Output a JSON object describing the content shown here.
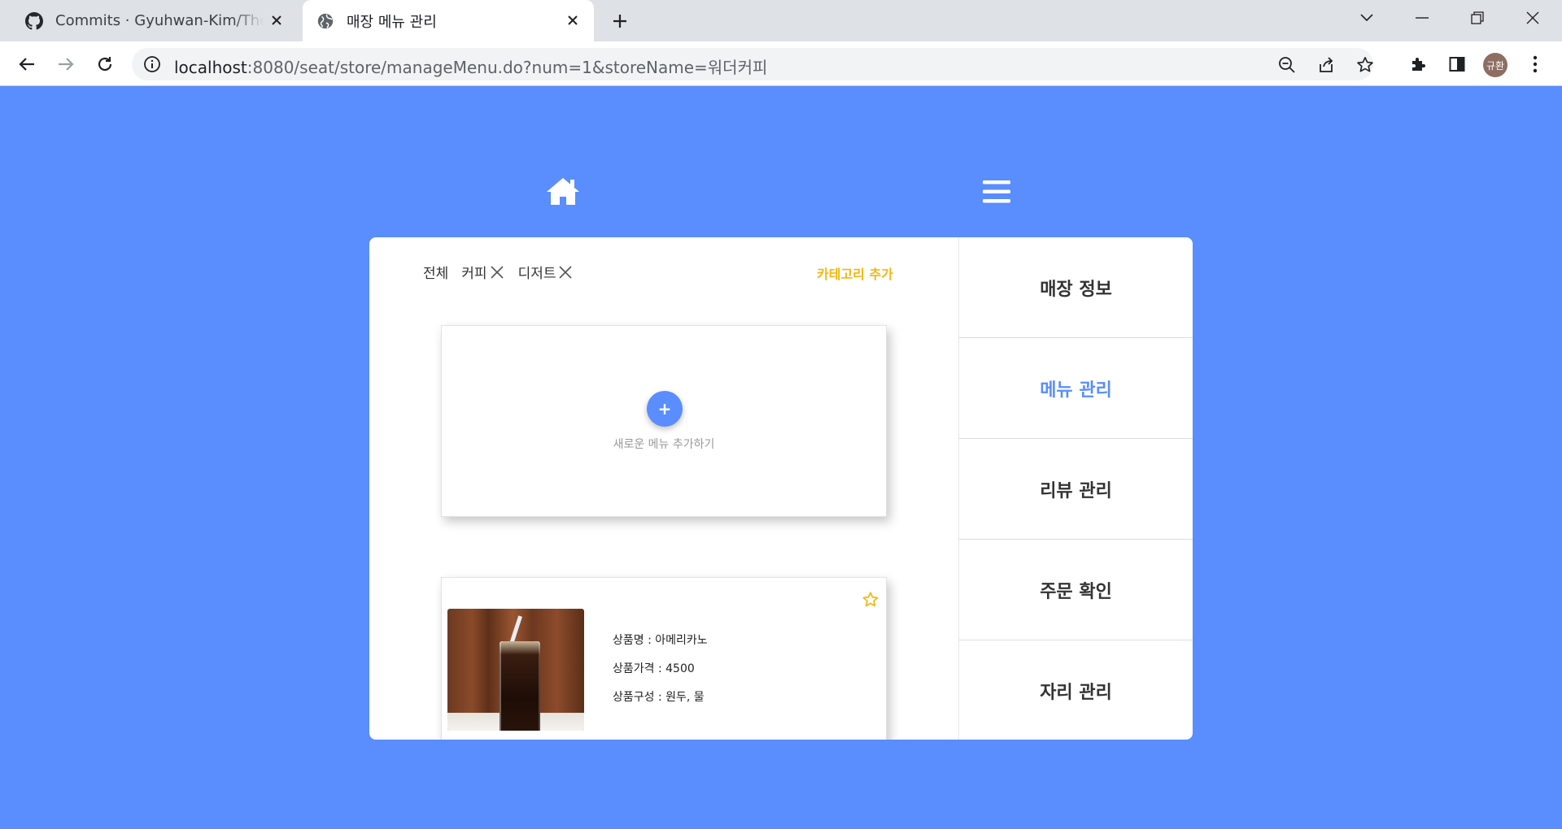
{
  "browser": {
    "tabs": [
      {
        "title": "Commits · Gyuhwan-Kim/TheSeat",
        "icon": "github-icon",
        "active": false
      },
      {
        "title": "매장 메뉴 관리",
        "icon": "globe-icon",
        "active": true
      }
    ],
    "url_host": "localhost",
    "url_rest": ":8080/seat/store/manageMenu.do?num=1&storeName=워더커피",
    "profile_initials": "규환"
  },
  "page": {
    "categories": [
      {
        "label": "전체",
        "removable": false
      },
      {
        "label": "커피",
        "removable": true
      },
      {
        "label": "디저트",
        "removable": true
      }
    ],
    "add_category_label": "카테고리 추가",
    "add_menu_button": "+",
    "add_menu_label": "새로운 메뉴 추가하기",
    "menu_items": [
      {
        "name_line": "상품명 : 아메리카노",
        "price_line": "상품가격 : 4500",
        "composition_line": "상품구성 : 원두, 물"
      }
    ],
    "side_menu": [
      {
        "label": "매장 정보",
        "active": false
      },
      {
        "label": "메뉴 관리",
        "active": true
      },
      {
        "label": "리뷰 관리",
        "active": false
      },
      {
        "label": "주문 확인",
        "active": false
      },
      {
        "label": "자리 관리",
        "active": false
      }
    ]
  },
  "colors": {
    "background": "#5a8dfd",
    "accent": "#5a8dfd",
    "category_add": "#f2b70e"
  }
}
